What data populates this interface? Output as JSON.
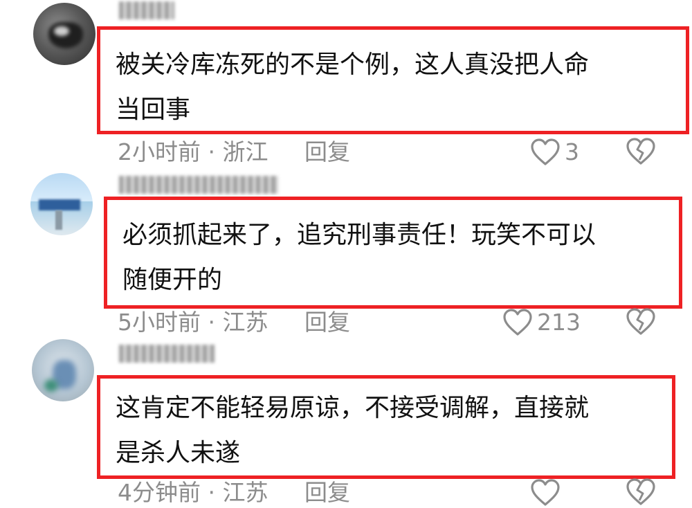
{
  "comments": [
    {
      "text_line1": "被关冷库冻死的不是个例，这人真没把人命",
      "text_line2": "当回事",
      "time": "2小时前",
      "separator": "·",
      "location": "浙江",
      "reply_label": "回复",
      "likes": "3"
    },
    {
      "text_line1": "必须抓起来了，追究刑事责任！玩笑不可以",
      "text_line2": "随便开的",
      "time": "5小时前",
      "separator": "·",
      "location": "江苏",
      "reply_label": "回复",
      "likes": "213"
    },
    {
      "text_line1": "这肯定不能轻易原谅，不接受调解，直接就",
      "text_line2": "是杀人未遂",
      "time": "4分钟前",
      "separator": "·",
      "location": "江苏",
      "reply_label": "回复",
      "likes": ""
    }
  ],
  "icons": {
    "like": "heart-outline-icon",
    "dislike": "broken-heart-icon"
  },
  "colors": {
    "highlight_border": "#ee2124",
    "meta_gray": "#8c8c8c",
    "text": "#111111"
  }
}
